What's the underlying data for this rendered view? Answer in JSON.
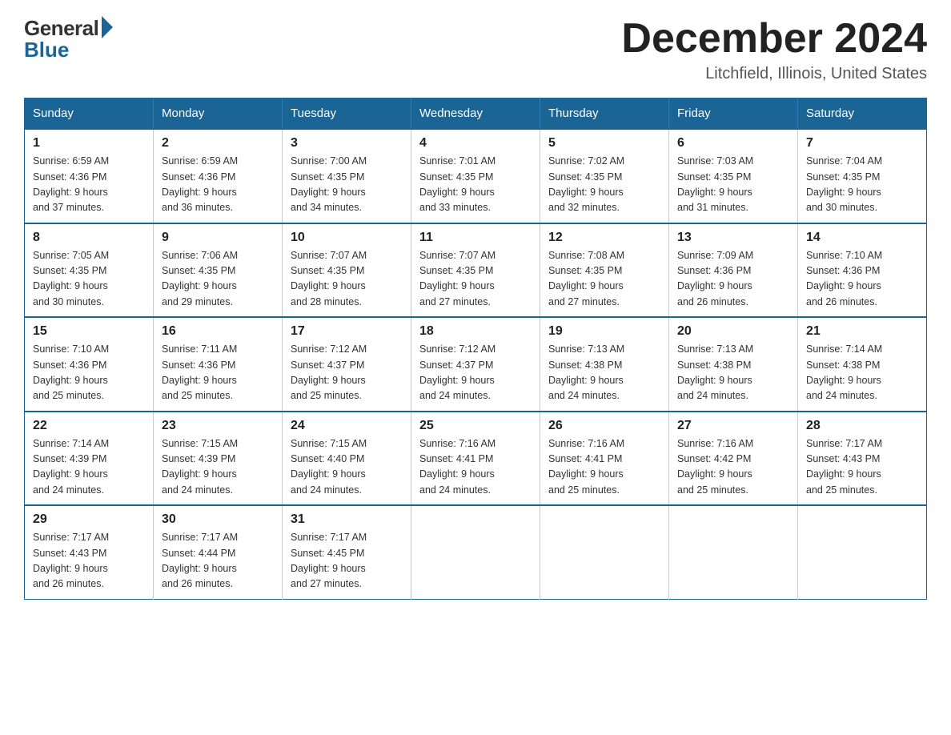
{
  "logo": {
    "general": "General",
    "blue": "Blue"
  },
  "title": "December 2024",
  "subtitle": "Litchfield, Illinois, United States",
  "days_of_week": [
    "Sunday",
    "Monday",
    "Tuesday",
    "Wednesday",
    "Thursday",
    "Friday",
    "Saturday"
  ],
  "weeks": [
    [
      {
        "day": "1",
        "sunrise": "6:59 AM",
        "sunset": "4:36 PM",
        "daylight": "9 hours and 37 minutes."
      },
      {
        "day": "2",
        "sunrise": "6:59 AM",
        "sunset": "4:36 PM",
        "daylight": "9 hours and 36 minutes."
      },
      {
        "day": "3",
        "sunrise": "7:00 AM",
        "sunset": "4:35 PM",
        "daylight": "9 hours and 34 minutes."
      },
      {
        "day": "4",
        "sunrise": "7:01 AM",
        "sunset": "4:35 PM",
        "daylight": "9 hours and 33 minutes."
      },
      {
        "day": "5",
        "sunrise": "7:02 AM",
        "sunset": "4:35 PM",
        "daylight": "9 hours and 32 minutes."
      },
      {
        "day": "6",
        "sunrise": "7:03 AM",
        "sunset": "4:35 PM",
        "daylight": "9 hours and 31 minutes."
      },
      {
        "day": "7",
        "sunrise": "7:04 AM",
        "sunset": "4:35 PM",
        "daylight": "9 hours and 30 minutes."
      }
    ],
    [
      {
        "day": "8",
        "sunrise": "7:05 AM",
        "sunset": "4:35 PM",
        "daylight": "9 hours and 30 minutes."
      },
      {
        "day": "9",
        "sunrise": "7:06 AM",
        "sunset": "4:35 PM",
        "daylight": "9 hours and 29 minutes."
      },
      {
        "day": "10",
        "sunrise": "7:07 AM",
        "sunset": "4:35 PM",
        "daylight": "9 hours and 28 minutes."
      },
      {
        "day": "11",
        "sunrise": "7:07 AM",
        "sunset": "4:35 PM",
        "daylight": "9 hours and 27 minutes."
      },
      {
        "day": "12",
        "sunrise": "7:08 AM",
        "sunset": "4:35 PM",
        "daylight": "9 hours and 27 minutes."
      },
      {
        "day": "13",
        "sunrise": "7:09 AM",
        "sunset": "4:36 PM",
        "daylight": "9 hours and 26 minutes."
      },
      {
        "day": "14",
        "sunrise": "7:10 AM",
        "sunset": "4:36 PM",
        "daylight": "9 hours and 26 minutes."
      }
    ],
    [
      {
        "day": "15",
        "sunrise": "7:10 AM",
        "sunset": "4:36 PM",
        "daylight": "9 hours and 25 minutes."
      },
      {
        "day": "16",
        "sunrise": "7:11 AM",
        "sunset": "4:36 PM",
        "daylight": "9 hours and 25 minutes."
      },
      {
        "day": "17",
        "sunrise": "7:12 AM",
        "sunset": "4:37 PM",
        "daylight": "9 hours and 25 minutes."
      },
      {
        "day": "18",
        "sunrise": "7:12 AM",
        "sunset": "4:37 PM",
        "daylight": "9 hours and 24 minutes."
      },
      {
        "day": "19",
        "sunrise": "7:13 AM",
        "sunset": "4:38 PM",
        "daylight": "9 hours and 24 minutes."
      },
      {
        "day": "20",
        "sunrise": "7:13 AM",
        "sunset": "4:38 PM",
        "daylight": "9 hours and 24 minutes."
      },
      {
        "day": "21",
        "sunrise": "7:14 AM",
        "sunset": "4:38 PM",
        "daylight": "9 hours and 24 minutes."
      }
    ],
    [
      {
        "day": "22",
        "sunrise": "7:14 AM",
        "sunset": "4:39 PM",
        "daylight": "9 hours and 24 minutes."
      },
      {
        "day": "23",
        "sunrise": "7:15 AM",
        "sunset": "4:39 PM",
        "daylight": "9 hours and 24 minutes."
      },
      {
        "day": "24",
        "sunrise": "7:15 AM",
        "sunset": "4:40 PM",
        "daylight": "9 hours and 24 minutes."
      },
      {
        "day": "25",
        "sunrise": "7:16 AM",
        "sunset": "4:41 PM",
        "daylight": "9 hours and 24 minutes."
      },
      {
        "day": "26",
        "sunrise": "7:16 AM",
        "sunset": "4:41 PM",
        "daylight": "9 hours and 25 minutes."
      },
      {
        "day": "27",
        "sunrise": "7:16 AM",
        "sunset": "4:42 PM",
        "daylight": "9 hours and 25 minutes."
      },
      {
        "day": "28",
        "sunrise": "7:17 AM",
        "sunset": "4:43 PM",
        "daylight": "9 hours and 25 minutes."
      }
    ],
    [
      {
        "day": "29",
        "sunrise": "7:17 AM",
        "sunset": "4:43 PM",
        "daylight": "9 hours and 26 minutes."
      },
      {
        "day": "30",
        "sunrise": "7:17 AM",
        "sunset": "4:44 PM",
        "daylight": "9 hours and 26 minutes."
      },
      {
        "day": "31",
        "sunrise": "7:17 AM",
        "sunset": "4:45 PM",
        "daylight": "9 hours and 27 minutes."
      },
      null,
      null,
      null,
      null
    ]
  ],
  "labels": {
    "sunrise": "Sunrise:",
    "sunset": "Sunset:",
    "daylight": "Daylight:"
  }
}
